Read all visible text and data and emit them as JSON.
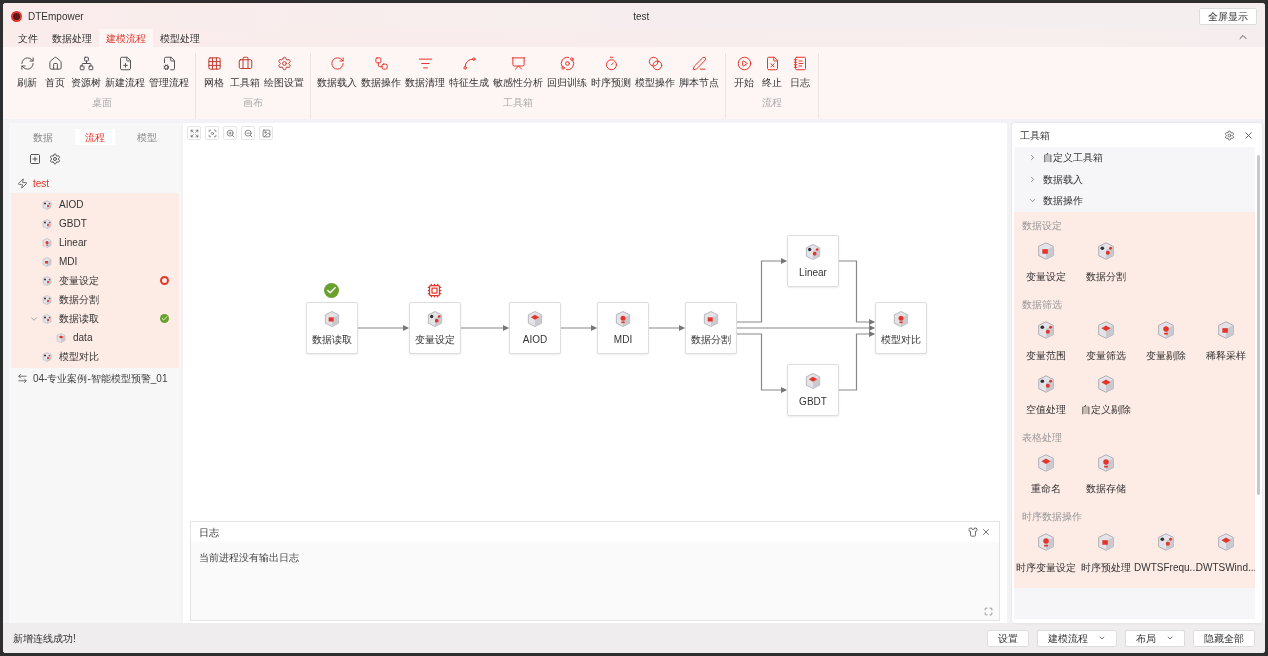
{
  "app": {
    "name": "DTEmpower",
    "title": "test",
    "fullscreen_button": "全屏显示"
  },
  "menu_tabs": [
    {
      "label": "文件",
      "selected": false
    },
    {
      "label": "数据处理",
      "selected": false
    },
    {
      "label": "建模流程",
      "selected": true
    },
    {
      "label": "模型处理",
      "selected": false
    }
  ],
  "ribbon": [
    {
      "name": "桌面",
      "items": [
        "刷新",
        "首页",
        "资源树",
        "新建流程",
        "管理流程"
      ]
    },
    {
      "name": "画布",
      "items": [
        "网格",
        "工具箱",
        "绘图设置"
      ]
    },
    {
      "name": "工具箱",
      "items": [
        "数据载入",
        "数据操作",
        "数据清理",
        "特征生成",
        "敏感性分析",
        "回归训练",
        "时序预测",
        "模型操作",
        "脚本节点"
      ]
    },
    {
      "name": "流程",
      "items": [
        "开始",
        "终止",
        "日志"
      ]
    }
  ],
  "left_panel": {
    "tabs": [
      {
        "label": "数据",
        "selected": false
      },
      {
        "label": "流程",
        "selected": true
      },
      {
        "label": "模型",
        "selected": false
      }
    ],
    "flows": [
      {
        "label": "test",
        "selected": true,
        "children": [
          {
            "label": "AIOD"
          },
          {
            "label": "GBDT"
          },
          {
            "label": "Linear"
          },
          {
            "label": "MDI"
          },
          {
            "label": "变量设定",
            "done": false,
            "flagged": true
          },
          {
            "label": "数据分割"
          },
          {
            "label": "数据读取",
            "done": true,
            "expanded": true,
            "children": [
              {
                "label": "data"
              }
            ]
          },
          {
            "label": "模型对比"
          }
        ]
      },
      {
        "label": "04-专业案例-智能模型预警_01",
        "selected": false
      }
    ]
  },
  "canvas": {
    "nodes": [
      {
        "label": "数据读取",
        "done": true
      },
      {
        "label": "变量设定",
        "done": false,
        "flagged": true
      },
      {
        "label": "AIOD"
      },
      {
        "label": "MDI"
      },
      {
        "label": "数据分割"
      },
      {
        "label": "Linear"
      },
      {
        "label": "GBDT"
      },
      {
        "label": "模型对比"
      }
    ],
    "log": {
      "title": "日志",
      "message": "当前进程没有输出日志"
    }
  },
  "toolbox": {
    "title": "工具箱",
    "sections": [
      {
        "label": "自定义工具箱",
        "expanded": false
      },
      {
        "label": "数据载入",
        "expanded": false
      },
      {
        "label": "数据操作",
        "expanded": true,
        "groups": [
          {
            "title": "数据设定",
            "items": [
              "变量设定",
              "数据分割"
            ]
          },
          {
            "title": "数据筛选",
            "items": [
              "变量范围",
              "变量筛选",
              "变量剔除",
              "稀释采样",
              "空值处理",
              "自定义剔除"
            ]
          },
          {
            "title": "表格处理",
            "items": [
              "重命名",
              "数据存储"
            ]
          },
          {
            "title": "时序数据操作",
            "items": [
              "时序变量设定",
              "时序预处理",
              "DWTSFrequ...",
              "DWTSWind..."
            ]
          }
        ]
      }
    ]
  },
  "status_bar": {
    "message": "新增连线成功!",
    "buttons": [
      {
        "label": "设置",
        "dropdown": false
      },
      {
        "label": "建模流程",
        "dropdown": true
      },
      {
        "label": "布局",
        "dropdown": true
      },
      {
        "label": "隐藏全部",
        "dropdown": false
      }
    ]
  }
}
